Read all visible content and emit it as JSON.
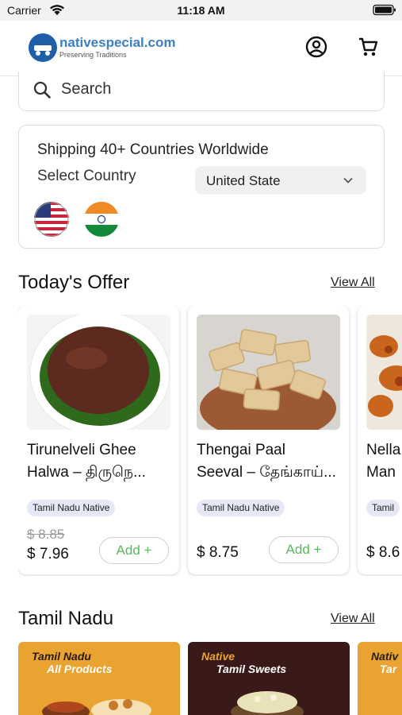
{
  "status_bar": {
    "carrier": "Carrier",
    "time": "11:18 AM"
  },
  "header": {
    "logo_name": "nativespecial.com",
    "logo_tagline": "Preserving Traditions",
    "account_icon": "account-circle-icon",
    "cart_icon": "cart-icon"
  },
  "search": {
    "placeholder": "Search"
  },
  "shipping": {
    "title": "Shipping 40+ Countries Worldwide",
    "select_label": "Select Country",
    "selected_country": "United State",
    "flags": [
      "us-flag-icon",
      "india-flag-icon"
    ]
  },
  "offers": {
    "title": "Today's Offer",
    "view_all": "View All",
    "products": [
      {
        "name_line1": "Tirunelveli Ghee",
        "name_line2": "Halwa – திருநெ...",
        "badge": "Tamil Nadu Native",
        "old_price": "$ 8.85",
        "price": "$ 7.96",
        "add_label": "Add +"
      },
      {
        "name_line1": "Thengai Paal",
        "name_line2": "Seeval – தேங்காய்...",
        "badge": "Tamil Nadu Native",
        "price": "$ 8.75",
        "add_label": "Add +"
      },
      {
        "name_line1": "Nella",
        "name_line2": "Man",
        "badge": "Tamil",
        "price": "$ 8.6"
      }
    ]
  },
  "tamil_nadu": {
    "title": "Tamil Nadu",
    "view_all": "View All",
    "categories": [
      {
        "line1": "Tamil Nadu",
        "line2": "All Products"
      },
      {
        "line1": "Native",
        "line2": "Tamil Sweets"
      },
      {
        "line1": "Nativ",
        "line2": "Tar"
      }
    ]
  },
  "colors": {
    "accent_green": "#58b85d",
    "badge_bg": "#e6e8f8",
    "brand_blue": "#3b7fc4",
    "category_orange": "#e8a330",
    "category_maroon": "#3a1a18"
  }
}
